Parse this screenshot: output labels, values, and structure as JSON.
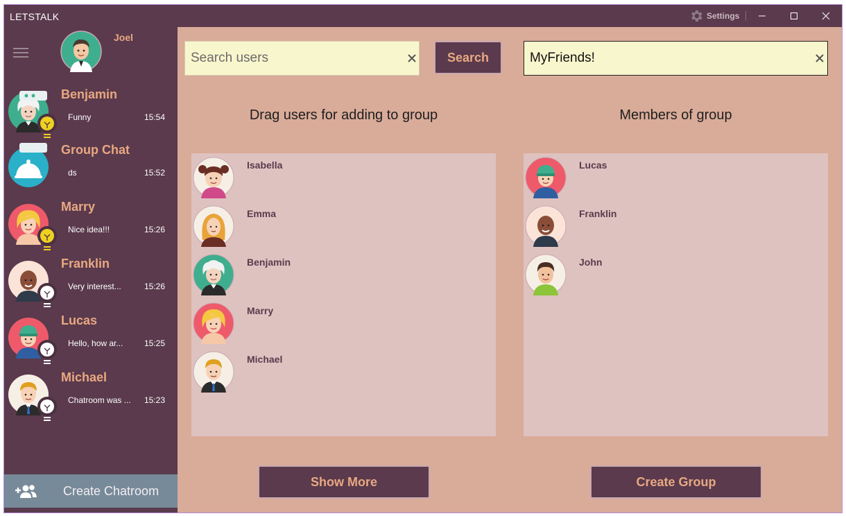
{
  "window": {
    "title": "LETSTALK",
    "settings_label": "Settings"
  },
  "sidebar": {
    "user_name": "Joel",
    "chats": [
      {
        "name": "Benjamin",
        "message": "Funny",
        "time": "15:54",
        "bulb": "yellow"
      },
      {
        "name": "Group Chat",
        "message": "ds",
        "time": "15:52",
        "bulb": "none"
      },
      {
        "name": "Marry",
        "message": "Nice idea!!!",
        "time": "15:26",
        "bulb": "yellow"
      },
      {
        "name": "Franklin",
        "message": "Very interest...",
        "time": "15:26",
        "bulb": "white"
      },
      {
        "name": "Lucas",
        "message": "Hello, how ar...",
        "time": "15:25",
        "bulb": "white"
      },
      {
        "name": "Michael",
        "message": "Chatroom was ...",
        "time": "15:23",
        "bulb": "white"
      }
    ],
    "create_chatroom_label": "Create Chatroom"
  },
  "main": {
    "search": {
      "placeholder": "Search users",
      "value": "",
      "button_label": "Search"
    },
    "group_name": {
      "value": "MyFriends!"
    },
    "available_title": "Drag users for adding to group",
    "members_title": "Members of group",
    "available_users": [
      "Isabella",
      "Emma",
      "Benjamin",
      "Marry",
      "Michael"
    ],
    "members": [
      "Lucas",
      "Franklin",
      "John"
    ],
    "show_more_label": "Show More",
    "create_group_label": "Create Group"
  },
  "colors": {
    "window_bg": "#5a3a4c",
    "main_bg": "#d9ab99",
    "accent_text": "#e8a882",
    "panel_bg": "#dec2c0",
    "input_bg": "#f8f6cc",
    "create_chatroom_bg": "#778a99"
  }
}
